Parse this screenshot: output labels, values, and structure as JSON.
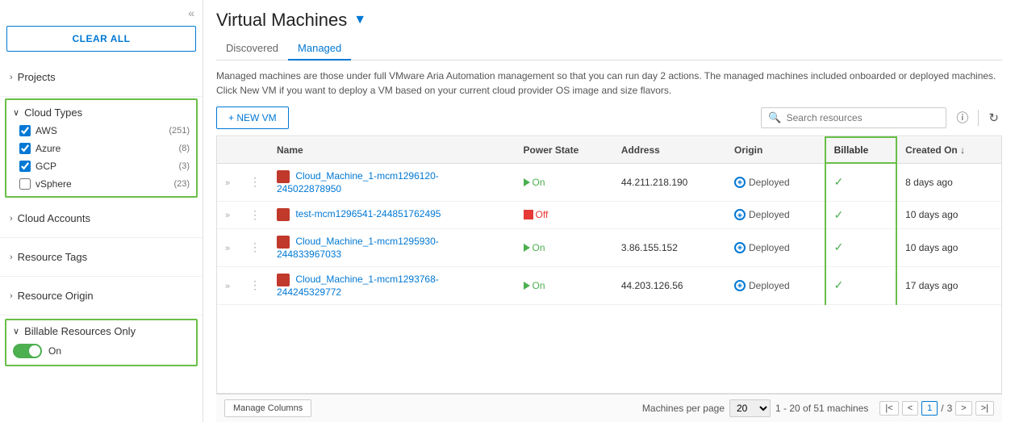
{
  "sidebar": {
    "collapse_label": "«",
    "clear_all_label": "CLEAR ALL",
    "projects_label": "Projects",
    "cloud_types": {
      "label": "Cloud Types",
      "items": [
        {
          "name": "AWS",
          "count": "(251)",
          "checked": true
        },
        {
          "name": "Azure",
          "count": "(8)",
          "checked": true
        },
        {
          "name": "GCP",
          "count": "(3)",
          "checked": true
        },
        {
          "name": "vSphere",
          "count": "(23)",
          "checked": false
        }
      ]
    },
    "cloud_accounts_label": "Cloud Accounts",
    "resource_tags_label": "Resource Tags",
    "resource_origin_label": "Resource Origin",
    "billable_resources": {
      "label": "Billable Resources Only",
      "toggle_on": true,
      "toggle_label": "On"
    }
  },
  "header": {
    "title": "Virtual Machines",
    "tabs": [
      {
        "label": "Discovered",
        "active": false
      },
      {
        "label": "Managed",
        "active": true
      }
    ],
    "description": "Managed machines are those under full VMware Aria Automation management so that you can run day 2 actions. The managed machines included onboarded or deployed machines. Click New VM if you want to deploy a VM based on your current cloud provider OS image and size flavors."
  },
  "toolbar": {
    "new_vm_label": "+ NEW VM",
    "search_placeholder": "Search resources",
    "info_icon": "ⓘ",
    "refresh_icon": "↻"
  },
  "table": {
    "columns": [
      {
        "key": "name",
        "label": "Name"
      },
      {
        "key": "power_state",
        "label": "Power State"
      },
      {
        "key": "address",
        "label": "Address"
      },
      {
        "key": "origin",
        "label": "Origin"
      },
      {
        "key": "billable",
        "label": "Billable"
      },
      {
        "key": "created_on",
        "label": "Created On"
      }
    ],
    "rows": [
      {
        "name": "Cloud_Machine_1-mcm1296120-245022878950",
        "power_state": "On",
        "power_on": true,
        "address": "44.211.218.190",
        "origin": "Deployed",
        "billable": true,
        "created_on": "8 days ago"
      },
      {
        "name": "test-mcm1296541-244851762495",
        "power_state": "Off",
        "power_on": false,
        "address": "",
        "origin": "Deployed",
        "billable": true,
        "created_on": "10 days ago"
      },
      {
        "name": "Cloud_Machine_1-mcm1295930-244833967033",
        "power_state": "On",
        "power_on": true,
        "address": "3.86.155.152",
        "origin": "Deployed",
        "billable": true,
        "created_on": "10 days ago"
      },
      {
        "name": "Cloud_Machine_1-mcm1293768-244245329772",
        "power_state": "On",
        "power_on": true,
        "address": "44.203.126.56",
        "origin": "Deployed",
        "billable": true,
        "created_on": "17 days ago"
      }
    ]
  },
  "footer": {
    "manage_cols_label": "Manage Columns",
    "per_page_label": "Machines per page",
    "per_page_value": "20",
    "range_label": "1 - 20 of 51 machines",
    "current_page": "1",
    "total_pages": "3"
  }
}
